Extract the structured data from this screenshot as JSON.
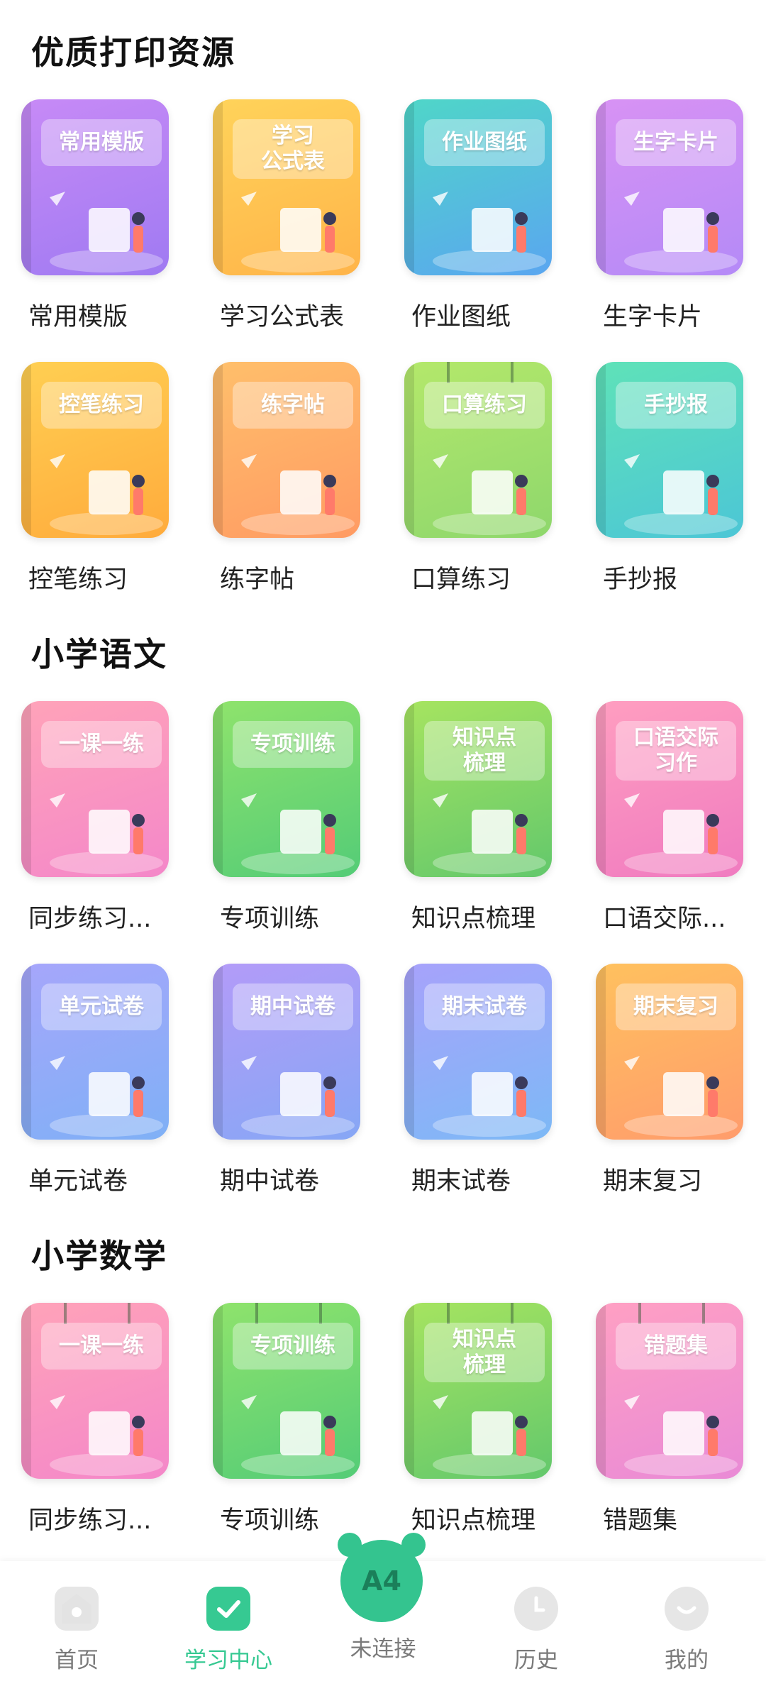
{
  "sections": [
    {
      "title": "优质打印资源",
      "items": [
        {
          "cover": "常用模版",
          "name": "常用模版",
          "c1": "#c78af6",
          "c2": "#9f7af2",
          "rings": false
        },
        {
          "cover": "学习\n公式表",
          "name": "学习公式表",
          "c1": "#ffd35a",
          "c2": "#ffb449",
          "rings": false
        },
        {
          "cover": "作业图纸",
          "name": "作业图纸",
          "c1": "#4fd6c8",
          "c2": "#5aa6f0",
          "rings": false
        },
        {
          "cover": "生字卡片",
          "name": "生字卡片",
          "c1": "#d892f4",
          "c2": "#b48af7",
          "rings": false
        },
        {
          "cover": "控笔练习",
          "name": "控笔练习",
          "c1": "#ffcf52",
          "c2": "#ffab3c",
          "rings": false
        },
        {
          "cover": "练字帖",
          "name": "练字帖",
          "c1": "#ffbf6b",
          "c2": "#ff9b63",
          "rings": false
        },
        {
          "cover": "口算练习",
          "name": "口算练习",
          "c1": "#b4e86b",
          "c2": "#8ed76c",
          "rings": true
        },
        {
          "cover": "手抄报",
          "name": "手抄报",
          "c1": "#5fe2b8",
          "c2": "#4cc6d6",
          "rings": false
        }
      ]
    },
    {
      "title": "小学语文",
      "items": [
        {
          "cover": "一课一练",
          "name": "同步练习...",
          "c1": "#ffa3b9",
          "c2": "#f487c9",
          "rings": false
        },
        {
          "cover": "专项训练",
          "name": "专项训练",
          "c1": "#8fe36c",
          "c2": "#54cc77",
          "rings": false
        },
        {
          "cover": "知识点\n梳理",
          "name": "知识点梳理",
          "c1": "#a6e460",
          "c2": "#63c86c",
          "rings": false
        },
        {
          "cover": "口语交际\n习作",
          "name": "口语交际...",
          "c1": "#ff9ec0",
          "c2": "#f07bc0",
          "rings": false
        },
        {
          "cover": "单元试卷",
          "name": "单元试卷",
          "c1": "#a6a6fb",
          "c2": "#7fb0f6",
          "rings": false
        },
        {
          "cover": "期中试卷",
          "name": "期中试卷",
          "c1": "#b39bf8",
          "c2": "#86a7f5",
          "rings": false
        },
        {
          "cover": "期末试卷",
          "name": "期末试卷",
          "c1": "#a7a2fb",
          "c2": "#7db9f6",
          "rings": false
        },
        {
          "cover": "期末复习",
          "name": "期末复习",
          "c1": "#ffc15e",
          "c2": "#ff9c6c",
          "rings": false
        }
      ]
    },
    {
      "title": "小学数学",
      "items": [
        {
          "cover": "一课一练",
          "name": "同步练习...",
          "c1": "#ffa3b9",
          "c2": "#f487c9",
          "rings": true
        },
        {
          "cover": "专项训练",
          "name": "专项训练",
          "c1": "#8fe36c",
          "c2": "#54cc77",
          "rings": true
        },
        {
          "cover": "知识点\n梳理",
          "name": "知识点梳理",
          "c1": "#a6e460",
          "c2": "#63c86c",
          "rings": true
        },
        {
          "cover": "错题集",
          "name": "错题集",
          "c1": "#ffa0c3",
          "c2": "#e98ad6",
          "rings": true
        }
      ]
    }
  ],
  "bottom_nav": {
    "home": "首页",
    "study": "学习中心",
    "center_badge": "A4",
    "center": "未连接",
    "history": "历史",
    "mine": "我的"
  },
  "colors": {
    "accent": "#36c992",
    "highlight": "#bdf2dc"
  },
  "icons": {
    "home": "home-icon",
    "study": "book-check-icon",
    "history": "clock-icon",
    "mine": "chat-bubble-icon"
  }
}
